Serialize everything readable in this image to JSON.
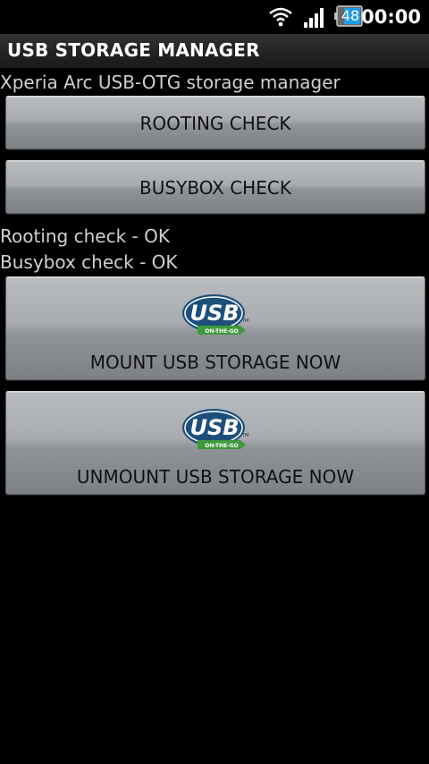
{
  "status_bar": {
    "battery": "48",
    "time": "00:00",
    "icons": [
      "wifi-icon",
      "signal-icon",
      "battery-icon"
    ]
  },
  "app": {
    "title": "USB STORAGE MANAGER",
    "subtitle": "Xperia Arc USB-OTG storage manager"
  },
  "buttons": {
    "rooting_check": "ROOTING CHECK",
    "busybox_check": "BUSYBOX CHECK",
    "mount": "MOUNT USB STORAGE NOW",
    "unmount": "UNMOUNT USB STORAGE NOW"
  },
  "status_messages": [
    "Rooting check - OK",
    "Busybox check - OK"
  ],
  "logo": {
    "text": "USB",
    "tagline": "ON-THE-GO",
    "tm": "TM",
    "colors": {
      "blue": "#1d4f7a",
      "green": "#3f9a3c"
    }
  }
}
